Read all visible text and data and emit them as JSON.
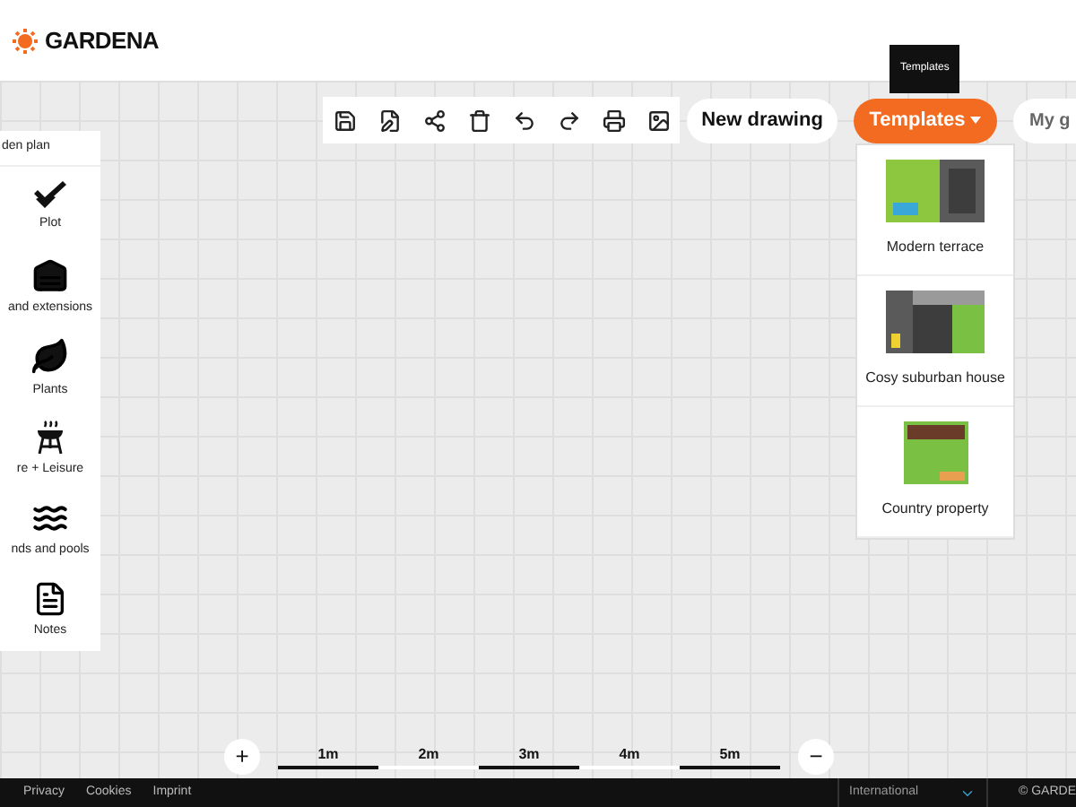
{
  "header": {
    "logo": "GARDENA"
  },
  "toolbar": {
    "tooltip": "Templates",
    "new_drawing": "New drawing",
    "templates": {
      "label": "Templates",
      "expanded": true
    },
    "my_gardens": "My g"
  },
  "templates_menu": [
    {
      "label": "Modern terrace"
    },
    {
      "label": "Cosy suburban house"
    },
    {
      "label": "Country property"
    }
  ],
  "sidebar": {
    "title": "den plan",
    "items": [
      {
        "label": "Plot"
      },
      {
        "label": "and extensions"
      },
      {
        "label": "Plants"
      },
      {
        "label": "re + Leisure"
      },
      {
        "label": "nds and pools"
      },
      {
        "label": "Notes"
      }
    ]
  },
  "scale": {
    "zoom_in": "+",
    "zoom_out": "−",
    "marks": [
      "1m",
      "2m",
      "3m",
      "4m",
      "5m"
    ]
  },
  "footer": {
    "links": [
      "Privacy",
      "Cookies",
      "Imprint"
    ],
    "region": "International",
    "copyright": "© GARDE"
  }
}
